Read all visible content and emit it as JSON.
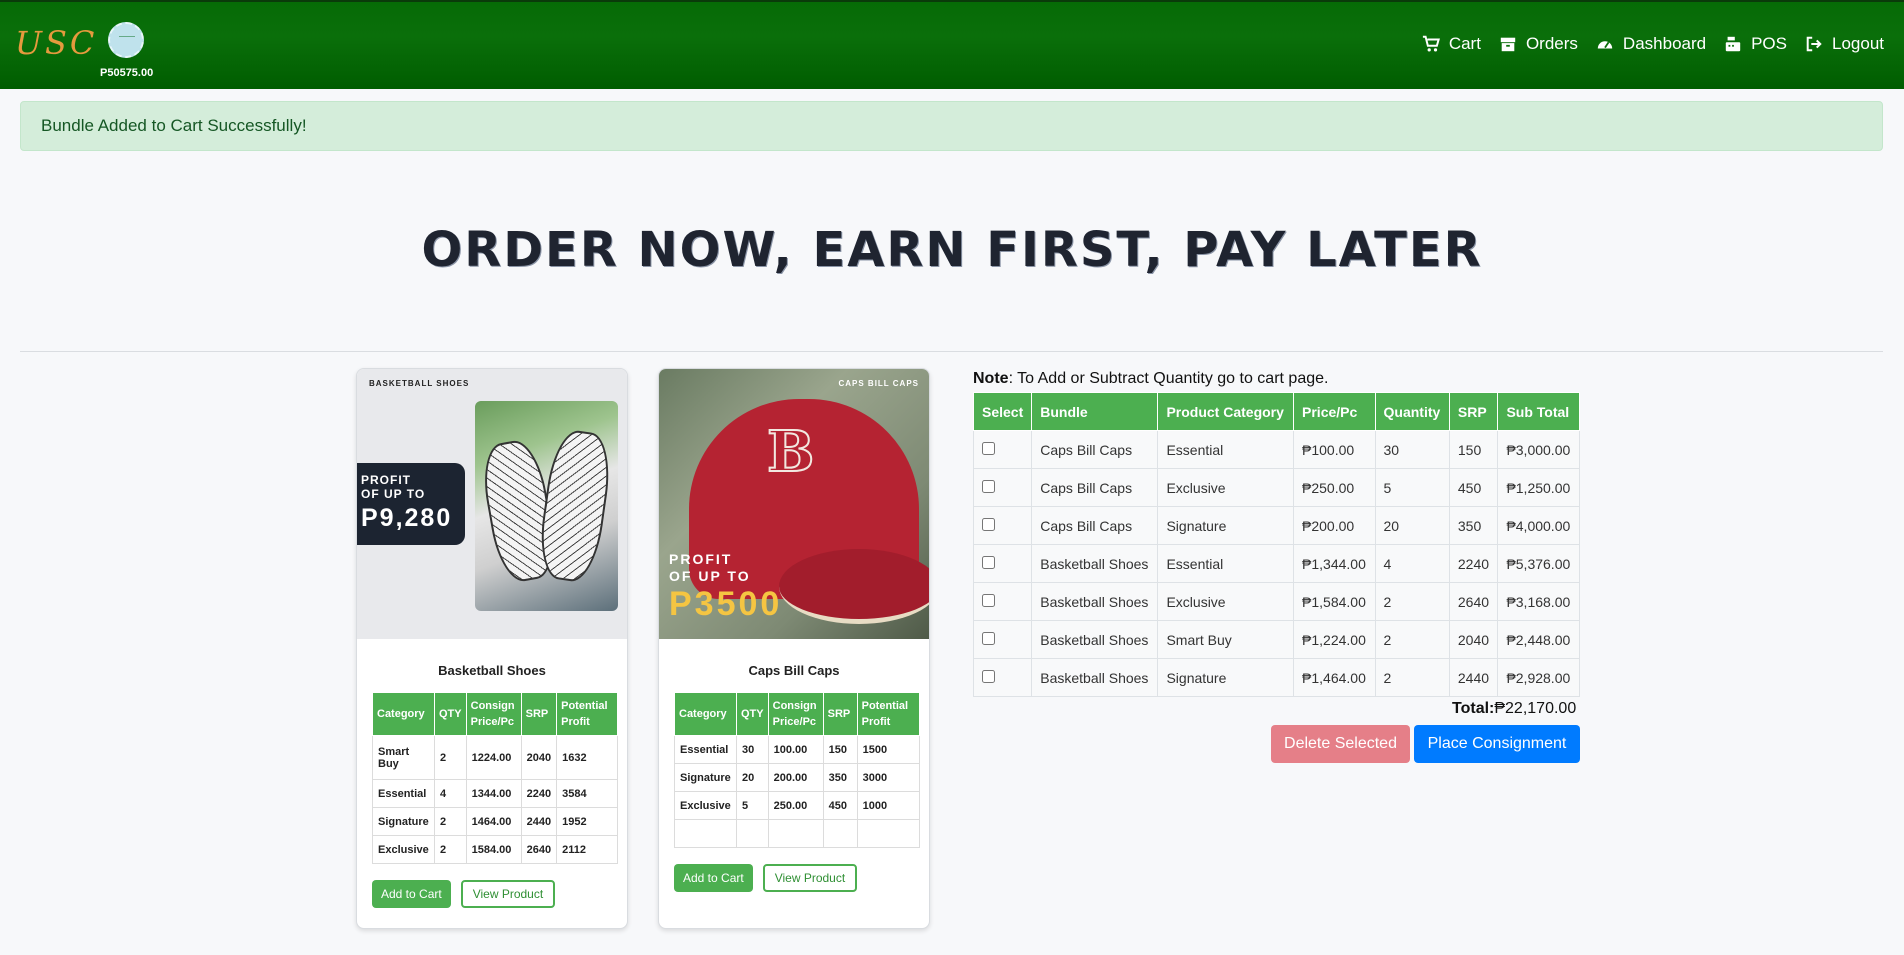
{
  "brand": {
    "logo_text": "USC",
    "balance": "P50575.00"
  },
  "nav": {
    "cart": "Cart",
    "orders": "Orders",
    "dashboard": "Dashboard",
    "pos": "POS",
    "logout": "Logout"
  },
  "alert": {
    "message": "Bundle Added to Cart Successfully!"
  },
  "hero": {
    "title": "ORDER NOW, EARN FIRST, PAY LATER"
  },
  "products": [
    {
      "image_tag": "BASKETBALL SHOES",
      "profit_line1": "PROFIT",
      "profit_line2": "OF UP TO",
      "profit_amount": "P9,280",
      "title": "Basketball Shoes",
      "headers": [
        "Category",
        "QTY",
        "Consign Price/Pc",
        "SRP",
        "Potential Profit"
      ],
      "rows": [
        [
          "Smart Buy",
          "2",
          "1224.00",
          "2040",
          "1632"
        ],
        [
          "Essential",
          "4",
          "1344.00",
          "2240",
          "3584"
        ],
        [
          "Signature",
          "2",
          "1464.00",
          "2440",
          "1952"
        ],
        [
          "Exclusive",
          "2",
          "1584.00",
          "2640",
          "2112"
        ]
      ],
      "add_label": "Add to Cart",
      "view_label": "View Product"
    },
    {
      "image_tag": "CAPS BILL CAPS",
      "cap_letter": "B",
      "profit_line1": "PROFIT",
      "profit_line2": "OF UP TO",
      "profit_amount": "P3500",
      "title": "Caps Bill Caps",
      "headers": [
        "Category",
        "QTY",
        "Consign Price/Pc",
        "SRP",
        "Potential Profit"
      ],
      "rows": [
        [
          "Essential",
          "30",
          "100.00",
          "150",
          "1500"
        ],
        [
          "Signature",
          "20",
          "200.00",
          "350",
          "3000"
        ],
        [
          "Exclusive",
          "5",
          "250.00",
          "450",
          "1000"
        ],
        [
          "",
          "",
          "",
          "",
          ""
        ]
      ],
      "add_label": "Add to Cart",
      "view_label": "View Product"
    }
  ],
  "cart": {
    "note_bold": "Note",
    "note_text": ": To Add or Subtract Quantity go to cart page.",
    "headers": [
      "Select",
      "Bundle",
      "Product Category",
      "Price/Pc",
      "Quantity",
      "SRP",
      "Sub Total"
    ],
    "rows": [
      [
        "Caps Bill Caps",
        "Essential",
        "₱100.00",
        "30",
        "150",
        "₱3,000.00"
      ],
      [
        "Caps Bill Caps",
        "Exclusive",
        "₱250.00",
        "5",
        "450",
        "₱1,250.00"
      ],
      [
        "Caps Bill Caps",
        "Signature",
        "₱200.00",
        "20",
        "350",
        "₱4,000.00"
      ],
      [
        "Basketball Shoes",
        "Essential",
        "₱1,344.00",
        "4",
        "2240",
        "₱5,376.00"
      ],
      [
        "Basketball Shoes",
        "Exclusive",
        "₱1,584.00",
        "2",
        "2640",
        "₱3,168.00"
      ],
      [
        "Basketball Shoes",
        "Smart Buy",
        "₱1,224.00",
        "2",
        "2040",
        "₱2,448.00"
      ],
      [
        "Basketball Shoes",
        "Signature",
        "₱1,464.00",
        "2",
        "2440",
        "₱2,928.00"
      ]
    ],
    "total_label": "Total:",
    "total_value": "₱22,170.00",
    "delete_label": "Delete Selected",
    "place_label": "Place Consignment"
  },
  "colors": {
    "nav_green": "#0a6f0a",
    "table_green": "#4caf50",
    "alert_bg": "#d4edda",
    "primary": "#007bff",
    "danger_soft": "#e57f88"
  }
}
